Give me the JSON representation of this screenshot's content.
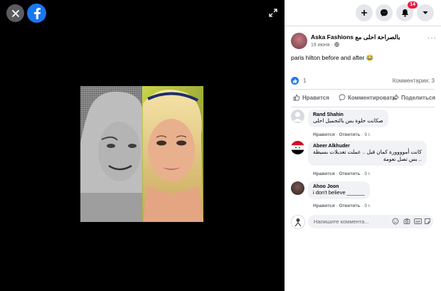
{
  "topbar": {
    "notifications_count": "14"
  },
  "post": {
    "author": "Aska Fashions باﻟﺼﺮاﺣﺔ اﺣﻠﻰ ﻣﻊ",
    "date": "19 июня",
    "date_separator": " · ",
    "privacy_icon": "globe-icon",
    "text": "paris hilton before and after",
    "emoji": "😂",
    "more_label": "···"
  },
  "stats": {
    "likes": "1",
    "comments": "Комментарии: 3"
  },
  "actions": {
    "like": "Нравится",
    "comment": "Комментировать",
    "share": "Поделиться"
  },
  "comments": [
    {
      "name": "Rand Shahin",
      "text": [
        "ﺻﻜﺎﻧﺖ ﺣﻠﻮة ﺑﺲ ﺑﺎﻟﺘﺠﻤﻴﻞ اﺣﻠﻰ"
      ],
      "like": "Нравится",
      "reply": "Ответить",
      "time": "9 г."
    },
    {
      "name": "Abeer Alkhuder",
      "text": [
        "ﻛﺎﻧﺖ أﻣﻮووورة ﻛﻤﺎن ﻗﺒﻞ .. ﻋﻤﻠﺖ ﺗﻌﺪﻳﻼت ﺑﺴﻴﻄﺔ",
        "ﺑﺲ ﺗﺼﻞ ﻧﻌﻮﻣﺔ .."
      ],
      "like": "Нравится",
      "reply": "Ответить",
      "time": "9 г."
    },
    {
      "name": "Ahoo Joon",
      "text": [
        "i don't believe ______"
      ],
      "like": "Нравится",
      "reply": "Ответить",
      "time": "9 г."
    }
  ],
  "composer": {
    "placeholder": "Напишите коммента..."
  },
  "colors": {
    "brand": "#1877f2",
    "badge": "#e41e3f",
    "bubble": "#f0f2f5",
    "secondary_text": "#65676b"
  }
}
